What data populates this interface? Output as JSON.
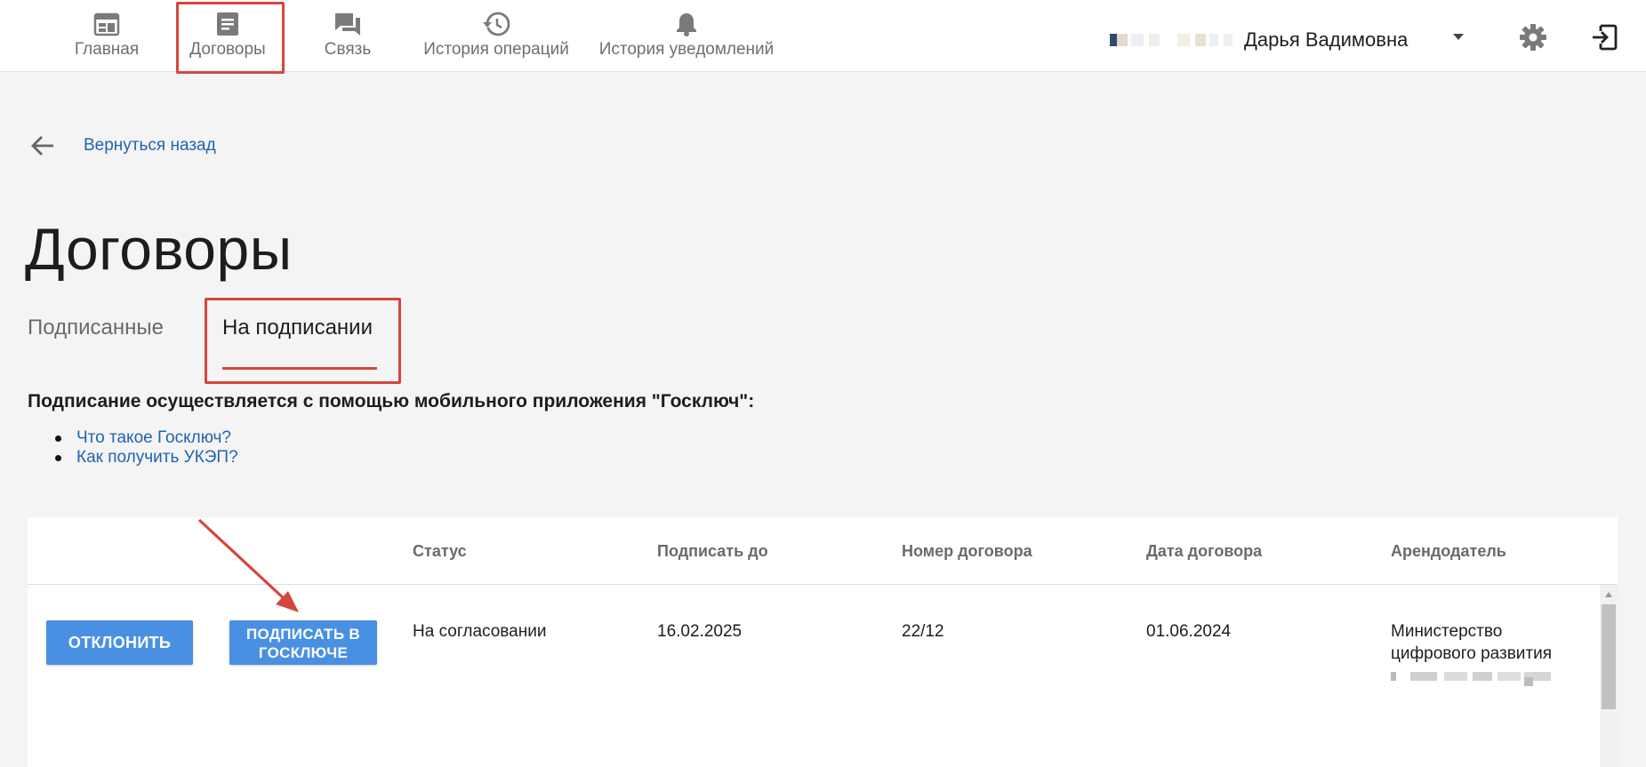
{
  "nav": {
    "items": [
      {
        "label": "Главная",
        "icon": "calendar-icon"
      },
      {
        "label": "Договоры",
        "icon": "document-icon"
      },
      {
        "label": "Связь",
        "icon": "chat-icon"
      },
      {
        "label": "История операций",
        "icon": "history-icon"
      },
      {
        "label": "История уведомлений",
        "icon": "bell-icon"
      }
    ],
    "active": "Договоры"
  },
  "user": {
    "name": "Дарья Вадимовна"
  },
  "back": {
    "label": "Вернуться назад"
  },
  "page": {
    "title": "Договоры",
    "tabs": [
      {
        "label": "Подписанные",
        "selected": false
      },
      {
        "label": "На подписании",
        "selected": true
      }
    ]
  },
  "info": {
    "text": "Подписание осуществляется с помощью мобильного приложения \"Госключ\":",
    "links": [
      "Что такое Госключ?",
      "Как получить УКЭП?"
    ]
  },
  "table": {
    "columns": [
      "Статус",
      "Подписать до",
      "Номер договора",
      "Дата договора",
      "Арендодатель"
    ],
    "rows": [
      {
        "actions": {
          "reject": "ОТКЛОНИТЬ",
          "sign_line1": "ПОДПИСАТЬ В",
          "sign_line2": "ГОСКЛЮЧЕ"
        },
        "status": "На согласовании",
        "sign_before": "16.02.2025",
        "contract_number": "22/12",
        "contract_date": "01.06.2024",
        "landlord_line1": "Министерство",
        "landlord_line2": "цифрового развития"
      }
    ]
  },
  "colors": {
    "accent": "#4a90e2",
    "link": "#1f64b0",
    "highlight": "#d5463d"
  }
}
